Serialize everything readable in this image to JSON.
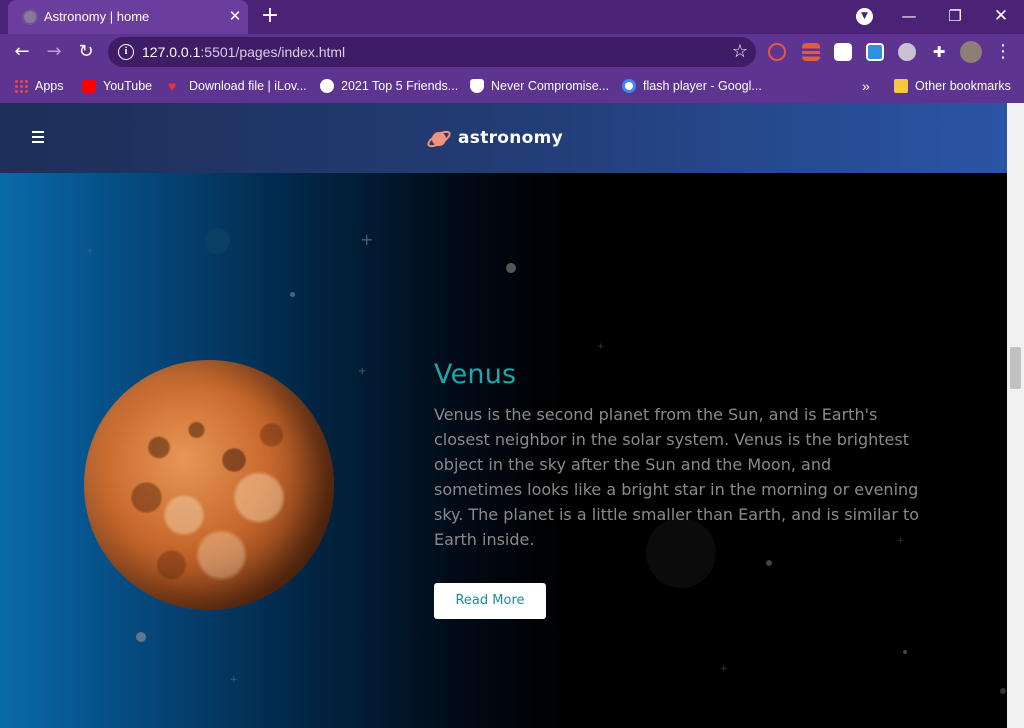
{
  "browser": {
    "tab_title": "Astronomy | home",
    "url_host": "127.0.0.1",
    "url_rest": ":5501/pages/index.html",
    "bookmarks": [
      {
        "label": "Apps",
        "icon": "apps-grid-icon"
      },
      {
        "label": "YouTube",
        "icon": "youtube-icon"
      },
      {
        "label": "Download file | iLov...",
        "icon": "heart-icon"
      },
      {
        "label": "2021 Top 5 Friends...",
        "icon": "globe-icon"
      },
      {
        "label": "Never Compromise...",
        "icon": "shield-icon"
      },
      {
        "label": "flash player - Googl...",
        "icon": "google-icon"
      }
    ],
    "overflow": "»",
    "other_bookmarks": "Other bookmarks"
  },
  "site": {
    "logo_text": "astronomy"
  },
  "hero": {
    "title": "Venus",
    "description": "Venus is the second planet from the Sun, and is Earth's closest neighbor in the solar system. Venus is the brightest object in the sky after the Sun and the Moon, and sometimes looks like a bright star in the morning or evening sky. The planet is a little smaller than Earth, and is similar to Earth inside.",
    "button_label": "Read More"
  },
  "colors": {
    "browser_chrome": "#5e3491",
    "heading": "#1fa5aa",
    "button_text": "#1c8b99"
  }
}
